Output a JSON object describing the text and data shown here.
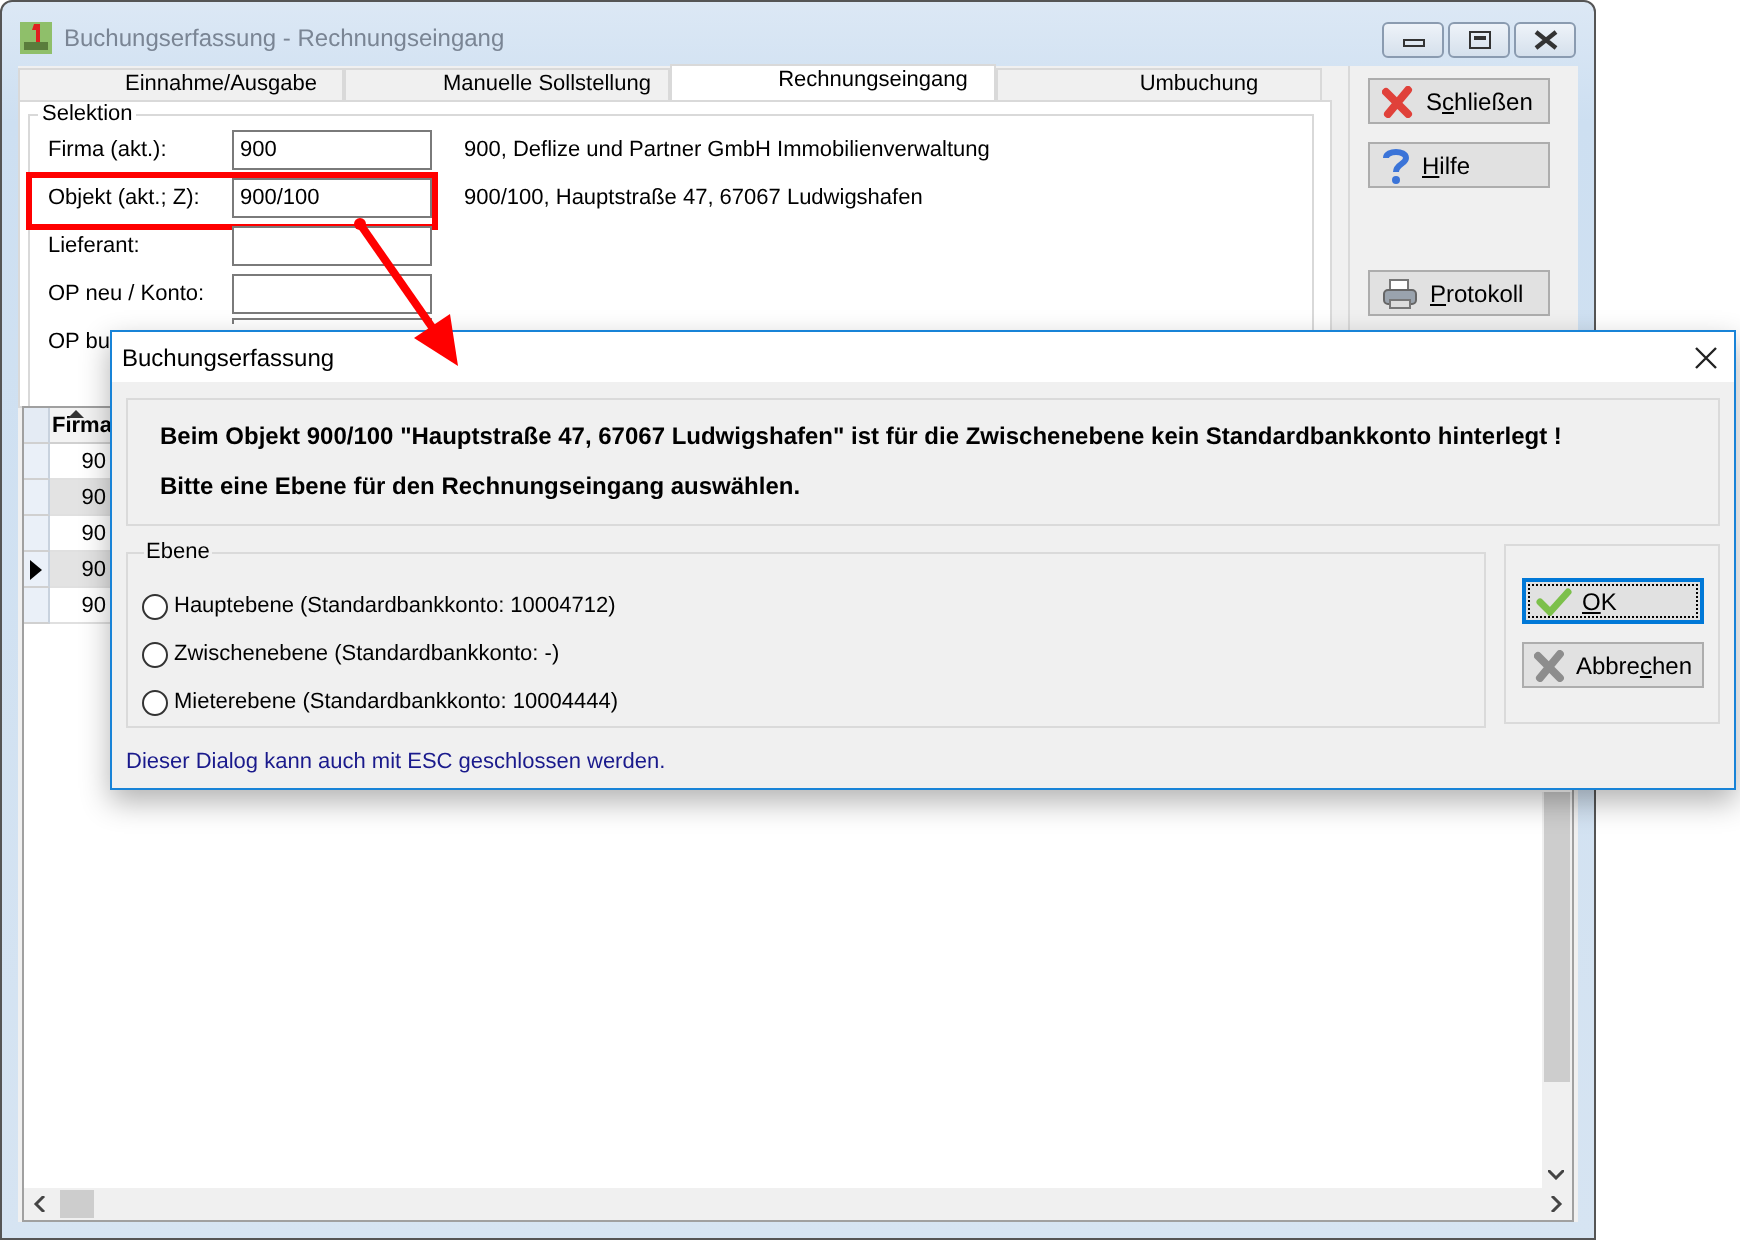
{
  "window": {
    "title": "Buchungserfassung - Rechnungseingang"
  },
  "tabs": [
    {
      "label": "Einnahme/Ausgabe",
      "selected": false
    },
    {
      "label": "Manuelle Sollstellung",
      "selected": false
    },
    {
      "label": "Rechnungseingang",
      "selected": true
    },
    {
      "label": "Umbuchung",
      "selected": false
    }
  ],
  "selection": {
    "title": "Selektion",
    "fields": [
      {
        "label": "Firma (akt.):",
        "value": "900",
        "info": "900,  Deflize und Partner GmbH Immobilienverwaltung",
        "highlighted": false,
        "cut": false
      },
      {
        "label": "Objekt (akt.; Z):",
        "value": "900/100",
        "info": "900/100,  Hauptstraße 47, 67067 Ludwigshafen",
        "highlighted": true,
        "cut": false
      },
      {
        "label": "Lieferant:",
        "highlighted": false,
        "cut": false
      },
      {
        "label": "OP neu / Konto:",
        "highlighted": false,
        "cut": false
      },
      {
        "label": "OP bu",
        "highlighted": false,
        "cut": true
      }
    ]
  },
  "side_buttons": [
    {
      "kind": "close",
      "prefix": "S",
      "mnemonic": "c",
      "rest": "hließen"
    },
    {
      "kind": "help",
      "mnemonic": "H",
      "rest": "ilfe"
    },
    {
      "kind": "print",
      "mnemonic": "P",
      "rest": "rotokoll"
    }
  ],
  "grid": {
    "columns": [
      {
        "label": "Firma",
        "sorted": true
      }
    ],
    "rows": [
      {
        "cells": [
          "90"
        ],
        "current": false
      },
      {
        "cells": [
          "90"
        ],
        "current": false
      },
      {
        "cells": [
          "90"
        ],
        "current": false
      },
      {
        "cells": [
          "90"
        ],
        "current": true
      },
      {
        "cells": [
          "90"
        ],
        "current": false
      }
    ]
  },
  "dialog": {
    "title": "Buchungserfassung",
    "messages": [
      "Beim Objekt 900/100 \"Hauptstraße 47, 67067 Ludwigshafen\" ist für die Zwischenebene kein Standardbankkonto hinterlegt !",
      "Bitte eine Ebene für den Rechnungseingang auswählen."
    ],
    "group": {
      "title": "Ebene",
      "options": [
        {
          "label": "Hauptebene  (Standardbankkonto: 10004712)",
          "selected": false
        },
        {
          "label": "Zwischenebene  (Standardbankkonto: -)",
          "selected": false
        },
        {
          "label": "Mieterebene  (Standardbankkonto: 10004444)",
          "selected": false
        }
      ]
    },
    "buttons": [
      {
        "kind": "ok",
        "mnemonic": "O",
        "rest": "K",
        "focused": true
      },
      {
        "kind": "cancel",
        "prefix": "Abbre",
        "mnemonic": "c",
        "rest": "hen",
        "focused": false
      }
    ],
    "footer": "Dieser Dialog kann auch mit ESC geschlossen werden."
  }
}
